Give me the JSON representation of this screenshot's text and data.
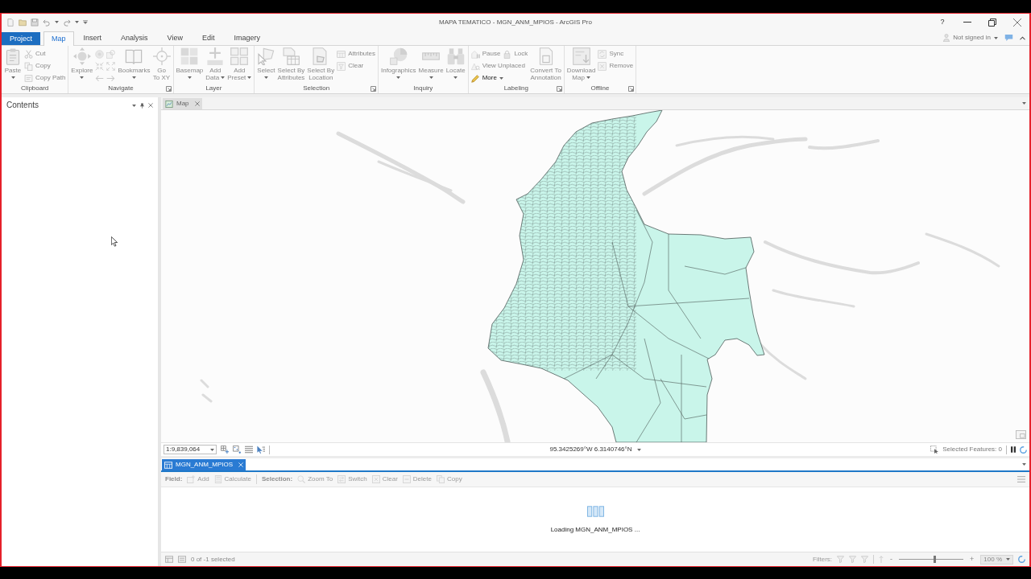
{
  "window": {
    "title": "MAPA TEMATICO - MGN_ANM_MPIOS - ArcGIS Pro",
    "help": "?"
  },
  "tabs": [
    {
      "label": "Project",
      "kind": "backstage",
      "selected": false
    },
    {
      "label": "Map",
      "kind": "tab",
      "selected": true
    },
    {
      "label": "Insert",
      "kind": "tab",
      "selected": false
    },
    {
      "label": "Analysis",
      "kind": "tab",
      "selected": false
    },
    {
      "label": "View",
      "kind": "tab",
      "selected": false
    },
    {
      "label": "Edit",
      "kind": "tab",
      "selected": false
    },
    {
      "label": "Imagery",
      "kind": "tab",
      "selected": false
    }
  ],
  "account": {
    "label": "Not signed in"
  },
  "ribbon": [
    {
      "label": "Clipboard",
      "launcher": false,
      "controls": [
        {
          "kind": "large",
          "label": "Paste",
          "dropdown": true,
          "disabled": true
        },
        {
          "kind": "stack",
          "rows": [
            [
              {
                "label": "Cut",
                "disabled": true
              }
            ],
            [
              {
                "label": "Copy",
                "disabled": true
              }
            ],
            [
              {
                "label": "Copy Path",
                "disabled": true
              }
            ]
          ]
        }
      ]
    },
    {
      "label": "Navigate",
      "launcher": true,
      "controls": [
        {
          "kind": "large",
          "label": "Explore",
          "dropdown": true,
          "disabled": true
        },
        {
          "kind": "tools",
          "disabled": true
        },
        {
          "kind": "large",
          "label": "Bookmarks",
          "dropdown": true,
          "disabled": true
        },
        {
          "kind": "large",
          "label": "Go\nTo XY",
          "dropdown": false,
          "disabled": true
        }
      ]
    },
    {
      "label": "Layer",
      "launcher": false,
      "controls": [
        {
          "kind": "large",
          "label": "Basemap",
          "dropdown": true,
          "disabled": true
        },
        {
          "kind": "large",
          "label": "Add\nData",
          "dropdown": true,
          "disabled": true
        },
        {
          "kind": "large",
          "label": "Add\nPreset",
          "dropdown": true,
          "disabled": true
        }
      ]
    },
    {
      "label": "Selection",
      "launcher": true,
      "controls": [
        {
          "kind": "large",
          "label": "Select",
          "dropdown": true,
          "disabled": true
        },
        {
          "kind": "large",
          "label": "Select By\nAttributes",
          "dropdown": false,
          "disabled": true
        },
        {
          "kind": "large",
          "label": "Select By\nLocation",
          "dropdown": false,
          "disabled": true
        },
        {
          "kind": "stack",
          "rows": [
            [
              {
                "label": "Attributes",
                "disabled": true
              }
            ],
            [
              {
                "label": "Clear",
                "disabled": true
              }
            ]
          ]
        }
      ]
    },
    {
      "label": "Inquiry",
      "launcher": false,
      "controls": [
        {
          "kind": "large",
          "label": "Infographics",
          "dropdown": true,
          "disabled": true
        },
        {
          "kind": "large",
          "label": "Measure",
          "dropdown": true,
          "disabled": true
        },
        {
          "kind": "large",
          "label": "Locate",
          "dropdown": true,
          "disabled": true
        }
      ]
    },
    {
      "label": "Labeling",
      "launcher": true,
      "controls": [
        {
          "kind": "stack",
          "rows": [
            [
              {
                "label": "Pause",
                "disabled": true
              },
              {
                "label": "Lock",
                "disabled": true
              }
            ],
            [
              {
                "label": "View Unplaced",
                "disabled": true
              }
            ],
            [
              {
                "label": "More",
                "dropdown": true,
                "disabled": false
              }
            ]
          ]
        },
        {
          "kind": "large",
          "label": "Convert To\nAnnotation",
          "dropdown": false,
          "disabled": true
        }
      ]
    },
    {
      "label": "Offline",
      "launcher": true,
      "controls": [
        {
          "kind": "large",
          "label": "Download\nMap",
          "dropdown": true,
          "disabled": true
        },
        {
          "kind": "stack",
          "rows": [
            [
              {
                "label": "Sync",
                "disabled": true
              }
            ],
            [
              {
                "label": "Remove",
                "disabled": true
              }
            ]
          ]
        }
      ]
    }
  ],
  "contents_pane": {
    "title": "Contents"
  },
  "map_view": {
    "tab": {
      "label": "Map",
      "active": false
    },
    "scale": "1:9,839,064",
    "coordinates": "95.3425269°W 6.3140746°N",
    "selected_features": "Selected Features: 0"
  },
  "attribute_table": {
    "tab": {
      "label": "MGN_ANM_MPIOS",
      "active": true
    },
    "toolbar": [
      {
        "kind": "label",
        "label": "Field:"
      },
      {
        "kind": "button",
        "label": "Add",
        "disabled": true
      },
      {
        "kind": "button",
        "label": "Calculate",
        "disabled": true
      },
      {
        "kind": "label",
        "label": "Selection:"
      },
      {
        "kind": "button",
        "label": "Zoom To",
        "disabled": true
      },
      {
        "kind": "button",
        "label": "Switch",
        "disabled": true
      },
      {
        "kind": "button",
        "label": "Clear",
        "disabled": true
      },
      {
        "kind": "button",
        "label": "Delete",
        "disabled": true
      },
      {
        "kind": "button",
        "label": "Copy",
        "disabled": true
      }
    ],
    "message": "Loading MGN_ANM_MPIOS ...",
    "selection_count": "0 of -1 selected",
    "filters_label": "Filters:",
    "zoom": {
      "minus": "-",
      "plus": "+",
      "level": 0.55,
      "value": "100 %"
    }
  }
}
